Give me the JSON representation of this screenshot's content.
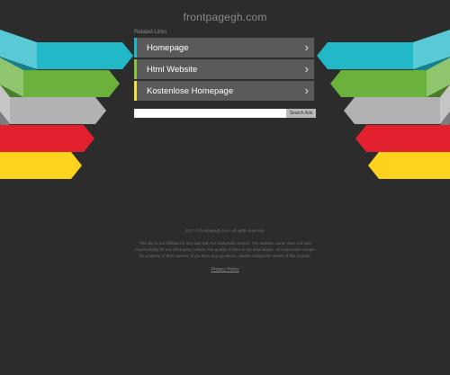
{
  "site_title": "frontpagegh.com",
  "related_links_label": "Related Links",
  "links": [
    {
      "label": "Homepage",
      "accent": "#21b8c7"
    },
    {
      "label": "Html Website",
      "accent": "#8cc63f"
    },
    {
      "label": "Kostenlose Homepage",
      "accent": "#f2e33a"
    }
  ],
  "search": {
    "placeholder": "",
    "button_label": "Search Ads"
  },
  "footer": {
    "copyright": "2017 © frontpagegh.com. All rights reserved.",
    "disclaimer": "This site is not affiliated in any way with the trademark owners. The website owner does not hold responsibility for any third-party content, the quality of links or the data shown. All trademarks remain the property of their owners. If you have any questions, please contact the owner of this domain.",
    "privacy": "Privacy Policy"
  },
  "decor_colors": {
    "teal": "#21b8c7",
    "green": "#6ab23c",
    "gray": "#b2b2b2",
    "red": "#e2202e",
    "yellow": "#ffd21f"
  }
}
